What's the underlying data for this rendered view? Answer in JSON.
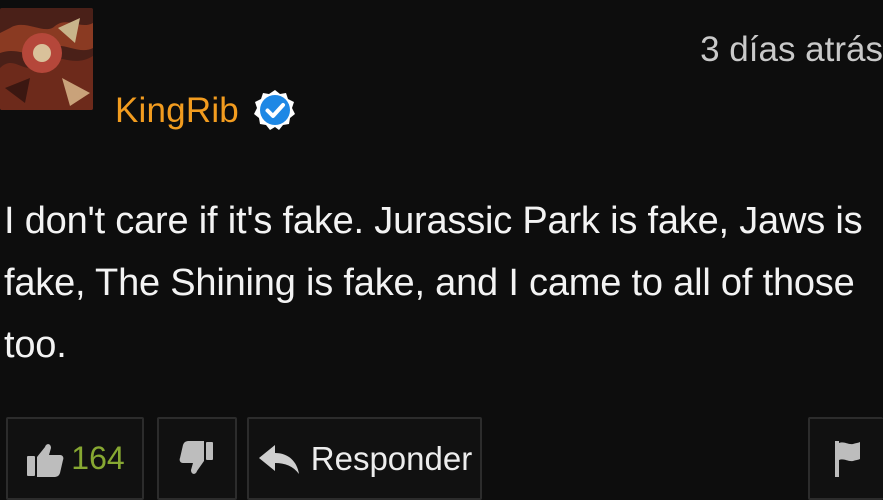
{
  "comment": {
    "username": "KingRib",
    "timestamp": "3 días atrás",
    "text": "I don't care if it's fake. Jurassic Park is fake, Jaws is fake, The Shining is fake, and I came to all of those too."
  },
  "actions": {
    "like_count": "164",
    "reply_label": "Responder"
  },
  "colors": {
    "username": "#f29c1f",
    "verified": "#1e88e5",
    "like_count": "#87a832",
    "background": "#0d0d0d"
  },
  "icons": {
    "avatar": "avatar-image",
    "verified": "verified-badge-icon",
    "like": "thumbs-up-icon",
    "dislike": "thumbs-down-icon",
    "reply": "reply-arrow-icon",
    "flag": "flag-icon"
  }
}
